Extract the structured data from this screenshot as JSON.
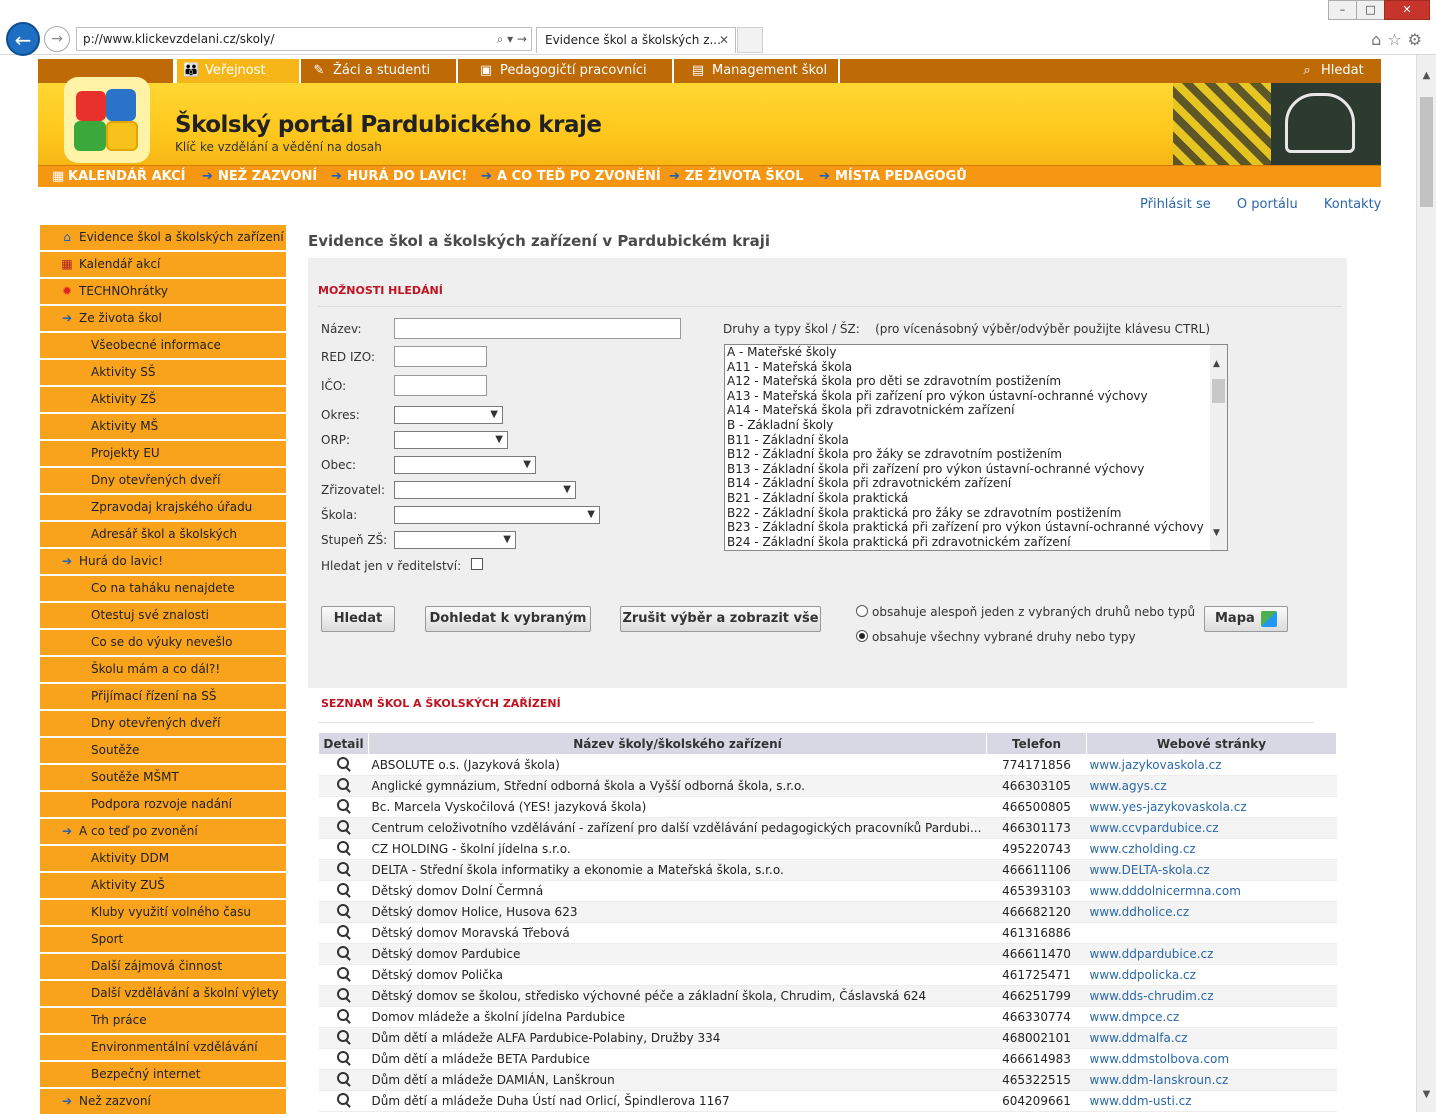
{
  "browser": {
    "address": "p://www.klickevzdelani.cz/skoly/",
    "tab_title": "Evidence škol a školských z...",
    "window_buttons": [
      "minimize",
      "maximize",
      "close"
    ]
  },
  "topnav": {
    "items": [
      {
        "label": "Veřejnost",
        "icon": "people-icon"
      },
      {
        "label": "Žáci a studenti",
        "icon": "student-icon"
      },
      {
        "label": "Pedagogičtí pracovníci",
        "icon": "teacher-icon"
      },
      {
        "label": "Management škol",
        "icon": "management-icon"
      }
    ],
    "search_label": "Hledat"
  },
  "banner": {
    "title": "Školský portál Pardubického kraje",
    "subtitle": "Klíč ke vzdělání a vědění na dosah"
  },
  "subnav": {
    "items": [
      "KALENDÁŘ AKCÍ",
      "NEŽ ZAZVONÍ",
      "HURÁ DO LAVIC!",
      "A CO TEĎ PO ZVONĚNÍ",
      "ZE ŽIVOTA ŠKOL",
      "MÍSTA PEDAGOGŮ"
    ]
  },
  "toplinks": [
    "Přihlásit se",
    "O portálu",
    "Kontakty"
  ],
  "sidebar": {
    "items": [
      {
        "label": "Evidence škol a školských zařízení",
        "level": "top",
        "icon": "home"
      },
      {
        "label": "Kalendář akcí",
        "level": "top",
        "icon": "cal"
      },
      {
        "label": "TECHNOhrátky",
        "level": "top",
        "icon": "gear"
      },
      {
        "label": "Ze života škol",
        "level": "top",
        "icon": "arrow"
      },
      {
        "label": "Všeobecné informace",
        "level": "sub"
      },
      {
        "label": "Aktivity SŠ",
        "level": "sub"
      },
      {
        "label": "Aktivity ZŠ",
        "level": "sub"
      },
      {
        "label": "Aktivity MŠ",
        "level": "sub"
      },
      {
        "label": "Projekty EU",
        "level": "sub"
      },
      {
        "label": "Dny otevřených dveří",
        "level": "sub"
      },
      {
        "label": "Zpravodaj krajského úřadu",
        "level": "sub"
      },
      {
        "label": "Adresář škol a školských zařízení",
        "level": "sub"
      },
      {
        "label": "Hurá do lavic!",
        "level": "top",
        "icon": "arrow"
      },
      {
        "label": "Co na taháku nenajdete",
        "level": "sub"
      },
      {
        "label": "Otestuj své znalosti",
        "level": "sub"
      },
      {
        "label": "Co se do výuky nevešlo",
        "level": "sub"
      },
      {
        "label": "Školu mám a co dál?!",
        "level": "sub"
      },
      {
        "label": "Přijímací řízení na SŠ",
        "level": "sub"
      },
      {
        "label": "Dny otevřených dveří",
        "level": "sub"
      },
      {
        "label": "Soutěže",
        "level": "sub"
      },
      {
        "label": "Soutěže MŠMT",
        "level": "sub"
      },
      {
        "label": "Podpora rozvoje nadání",
        "level": "sub"
      },
      {
        "label": "A co teď po zvonění",
        "level": "top",
        "icon": "arrow"
      },
      {
        "label": "Aktivity DDM",
        "level": "sub"
      },
      {
        "label": "Aktivity ZUŠ",
        "level": "sub"
      },
      {
        "label": "Kluby využití volného času",
        "level": "sub"
      },
      {
        "label": "Sport",
        "level": "sub"
      },
      {
        "label": "Další zájmová činnost",
        "level": "sub"
      },
      {
        "label": "Další vzdělávání a školní výlety",
        "level": "sub"
      },
      {
        "label": "Trh práce",
        "level": "sub"
      },
      {
        "label": "Environmentální vzdělávání",
        "level": "sub"
      },
      {
        "label": "Bezpečný internet",
        "level": "sub"
      },
      {
        "label": "Než zazvoní",
        "level": "top",
        "icon": "arrow"
      }
    ]
  },
  "main": {
    "heading": "Evidence škol a školských zařízení v Pardubickém kraji",
    "search": {
      "section_title": "MOŽNOSTI HLEDÁNÍ",
      "fields": {
        "nazev": "Název:",
        "red_izo": "RED IZO:",
        "ico": "IČO:",
        "okres": "Okres:",
        "orp": "ORP:",
        "obec": "Obec:",
        "zrizovatel": "Zřizovatel:",
        "skola": "Škola:",
        "stupen": "Stupeň ZŠ:",
        "jen_reditelstvi": "Hledat jen v ředitelství:"
      },
      "druhy_label": "Druhy a typy škol / ŠZ:    (pro vícenásobný výběr/odvýběr použijte klávesu CTRL)",
      "druhy_options": [
        "A - Mateřské školy",
        "A11 - Mateřská škola",
        "A12 - Mateřská škola pro děti se zdravotním postižením",
        "A13 - Mateřská škola při zařízení pro výkon ústavní-ochranné výchovy",
        "A14 - Mateřská škola při zdravotnickém zařízení",
        "B - Základní školy",
        "B11 - Základní škola",
        "B12 - Základní škola pro žáky se zdravotním postižením",
        "B13 - Základní škola při zařízení pro výkon ústavní-ochranné výchovy",
        "B14 - Základní škola při zdravotnickém zařízení",
        "B21 - Základní škola praktická",
        "B22 - Základní škola praktická pro žáky se zdravotním postižením",
        "B23 - Základní škola praktická při zařízení pro výkon ústavní-ochranné výchovy",
        "B24 - Základní škola praktická při zdravotnickém zařízení"
      ],
      "buttons": {
        "hledat": "Hledat",
        "dohledat": "Dohledat k vybraným",
        "zrusit": "Zrušit výběr a zobrazit vše",
        "mapa": "Mapa"
      },
      "radio": {
        "any": "obsahuje alespoň jeden z vybraných druhů nebo typů",
        "all": "obsahuje všechny vybrané druhy nebo typy",
        "selected": "all"
      }
    },
    "list": {
      "section_title": "SEZNAM ŠKOL A ŠKOLSKÝCH ZAŘÍZENÍ",
      "columns": [
        "Detail",
        "Název školy/školského zařízení",
        "Telefon",
        "Webové stránky"
      ],
      "rows": [
        {
          "name": "ABSOLUTE o.s. (Jazyková škola)",
          "tel": "774171856",
          "web": "www.jazykovaskola.cz"
        },
        {
          "name": "Anglické gymnázium, Střední odborná škola a Vyšší odborná škola, s.r.o.",
          "tel": "466303105",
          "web": "www.agys.cz"
        },
        {
          "name": "Bc. Marcela Vyskočilová (YES! jazyková škola)",
          "tel": "466500805",
          "web": "www.yes-jazykovaskola.cz"
        },
        {
          "name": "Centrum celoživotního vzdělávání - zařízení pro další vzdělávání pedagogických pracovníků Pardubi...",
          "tel": "466301173",
          "web": "www.ccvpardubice.cz"
        },
        {
          "name": "CZ HOLDING - školní jídelna s.r.o.",
          "tel": "495220743",
          "web": "www.czholding.cz"
        },
        {
          "name": "DELTA - Střední škola informatiky a ekonomie a Mateřská škola, s.r.o.",
          "tel": "466611106",
          "web": "www.DELTA-skola.cz"
        },
        {
          "name": "Dětský domov Dolní Čermná",
          "tel": "465393103",
          "web": "www.dddolnicermna.com"
        },
        {
          "name": "Dětský domov Holice, Husova 623",
          "tel": "466682120",
          "web": "www.ddholice.cz"
        },
        {
          "name": "Dětský domov Moravská Třebová",
          "tel": "461316886",
          "web": ""
        },
        {
          "name": "Dětský domov Pardubice",
          "tel": "466611470",
          "web": "www.ddpardubice.cz"
        },
        {
          "name": "Dětský domov Polička",
          "tel": "461725471",
          "web": "www.ddpolicka.cz"
        },
        {
          "name": "Dětský domov se školou, středisko výchovné péče a základní škola, Chrudim, Čáslavská 624",
          "tel": "466251799",
          "web": "www.dds-chrudim.cz"
        },
        {
          "name": "Domov mládeže a školní jídelna Pardubice",
          "tel": "466330774",
          "web": "www.dmpce.cz"
        },
        {
          "name": "Dům dětí a mládeže ALFA Pardubice-Polabiny, Družby 334",
          "tel": "468002101",
          "web": "www.ddmalfa.cz"
        },
        {
          "name": "Dům dětí a mládeže BETA Pardubice",
          "tel": "466614983",
          "web": "www.ddmstolbova.com"
        },
        {
          "name": "Dům dětí a mládeže DAMIÁN, Lanškroun",
          "tel": "465322515",
          "web": "www.ddm-lanskroun.cz"
        },
        {
          "name": "Dům dětí a mládeže Duha Ústí nad Orlicí, Špindlerova 1167",
          "tel": "604209661",
          "web": "www.ddm-usti.cz"
        }
      ]
    }
  }
}
